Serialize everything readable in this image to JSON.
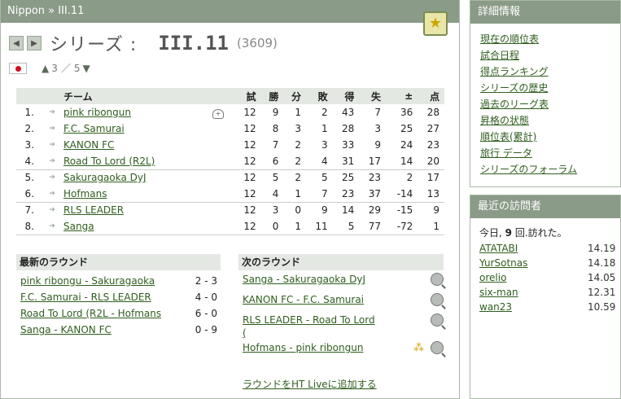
{
  "breadcrumb": "Nippon » III.11",
  "series": {
    "label": "シリーズ :",
    "name": "III.11",
    "id": "(3609)",
    "level_up": "3",
    "level_sep": "／",
    "level_down": "5"
  },
  "standings": {
    "headers": [
      "チーム",
      "試",
      "勝",
      "分",
      "敗",
      "得",
      "失",
      "±",
      "点"
    ],
    "rows": [
      {
        "pos": "1.",
        "team": "pink ribongun",
        "gp": "12",
        "w": "9",
        "d": "1",
        "l": "2",
        "gf": "43",
        "ga": "7",
        "diff": "36",
        "pts": "28",
        "mgr": true
      },
      {
        "pos": "2.",
        "team": "F.C. Samurai",
        "gp": "12",
        "w": "8",
        "d": "3",
        "l": "1",
        "gf": "28",
        "ga": "3",
        "diff": "25",
        "pts": "27"
      },
      {
        "pos": "3.",
        "team": "KANON FC",
        "gp": "12",
        "w": "7",
        "d": "2",
        "l": "3",
        "gf": "33",
        "ga": "9",
        "diff": "24",
        "pts": "23"
      },
      {
        "pos": "4.",
        "team": "Road To Lord (R2L)",
        "gp": "12",
        "w": "6",
        "d": "2",
        "l": "4",
        "gf": "31",
        "ga": "17",
        "diff": "14",
        "pts": "20"
      },
      {
        "pos": "5.",
        "team": "Sakuragaoka DyJ",
        "gp": "12",
        "w": "5",
        "d": "2",
        "l": "5",
        "gf": "25",
        "ga": "23",
        "diff": "2",
        "pts": "17"
      },
      {
        "pos": "6.",
        "team": "Hofmans",
        "gp": "12",
        "w": "4",
        "d": "1",
        "l": "7",
        "gf": "23",
        "ga": "37",
        "diff": "-14",
        "pts": "13"
      },
      {
        "pos": "7.",
        "team": "RLS LEADER",
        "gp": "12",
        "w": "3",
        "d": "0",
        "l": "9",
        "gf": "14",
        "ga": "29",
        "diff": "-15",
        "pts": "9"
      },
      {
        "pos": "8.",
        "team": "Sanga",
        "gp": "12",
        "w": "0",
        "d": "1",
        "l": "11",
        "gf": "5",
        "ga": "77",
        "diff": "-72",
        "pts": "1"
      }
    ]
  },
  "latest_round": {
    "title": "最新のラウンド",
    "matches": [
      {
        "match": "pink ribongu - Sakuragaoka",
        "score": "2 - 3"
      },
      {
        "match": "F.C. Samurai - RLS LEADER",
        "score": "4 - 0"
      },
      {
        "match": "Road To Lord (R2L - Hofmans",
        "score": "6 - 0"
      },
      {
        "match": "Sanga - KANON FC",
        "score": "0 - 9"
      }
    ]
  },
  "next_round": {
    "title": "次のラウンド",
    "matches": [
      {
        "match": "Sanga - Sakuragaoka DyJ",
        "live": false
      },
      {
        "match": "KANON FC - F.C. Samurai",
        "live": false
      },
      {
        "match": "RLS LEADER - Road To Lord (",
        "live": false
      },
      {
        "match": "Hofmans - pink ribongun",
        "live": true
      }
    ],
    "add_live": "ラウンドをHT Liveに追加する"
  },
  "details": {
    "title": "詳細情報",
    "links": [
      "現在の順位表",
      "試合日程",
      "得点ランキング",
      "シリーズの歴史",
      "過去のリーグ表",
      "昇格の状態",
      "順位表(累計)",
      "旅行 データ",
      "シリーズのフォーラム"
    ]
  },
  "visitors": {
    "title": "最近の訪問者",
    "count_prefix": "今日, ",
    "count": "9",
    "count_suffix": " 回.訪れた。",
    "list": [
      {
        "name": "ATATABI",
        "time": "14.19"
      },
      {
        "name": "YurSotnas",
        "time": "14.18"
      },
      {
        "name": "orelio",
        "time": "14.05"
      },
      {
        "name": "six-man",
        "time": "12.31"
      },
      {
        "name": "wan23",
        "time": "10.59"
      }
    ]
  }
}
